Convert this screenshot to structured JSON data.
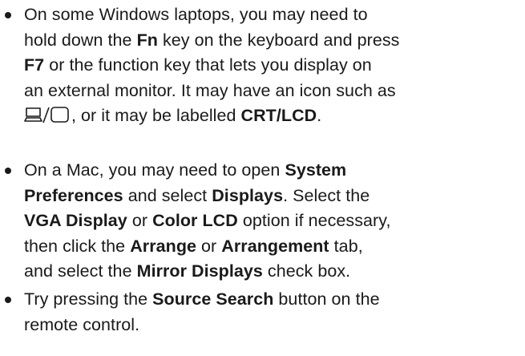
{
  "items": [
    {
      "lines": [
        [
          {
            "t": "On some Windows laptops, you may need to"
          }
        ],
        [
          {
            "t": "hold down the "
          },
          {
            "t": "Fn",
            "b": true
          },
          {
            "t": " key on the keyboard and press"
          }
        ],
        [
          {
            "t": "F7",
            "b": true
          },
          {
            "t": " or the function key that lets you display on"
          }
        ],
        [
          {
            "t": "an external monitor. It may have an icon such as"
          }
        ],
        [
          {
            "icon": "laptop-monitor-icon"
          },
          {
            "t": ", or it may be labelled "
          },
          {
            "t": "CRT/LCD",
            "b": true
          },
          {
            "t": "."
          }
        ]
      ]
    },
    {
      "lines": [
        [
          {
            "t": "On a Mac, you may need to open "
          },
          {
            "t": "System",
            "b": true
          }
        ],
        [
          {
            "t": "Preferences",
            "b": true
          },
          {
            "t": " and select "
          },
          {
            "t": "Displays",
            "b": true
          },
          {
            "t": ". Select the"
          }
        ],
        [
          {
            "t": "VGA Display",
            "b": true
          },
          {
            "t": " or "
          },
          {
            "t": "Color LCD",
            "b": true
          },
          {
            "t": " option if necessary,"
          }
        ],
        [
          {
            "t": "then click the "
          },
          {
            "t": "Arrange",
            "b": true
          },
          {
            "t": " or "
          },
          {
            "t": "Arrangement",
            "b": true
          },
          {
            "t": " tab,"
          }
        ],
        [
          {
            "t": "and select the "
          },
          {
            "t": "Mirror Displays",
            "b": true
          },
          {
            "t": " check box."
          }
        ]
      ]
    },
    {
      "lines": [
        [
          {
            "t": "Try pressing the "
          },
          {
            "t": "Source Search",
            "b": true
          },
          {
            "t": " button on the"
          }
        ],
        [
          {
            "t": "remote control."
          }
        ]
      ]
    }
  ]
}
